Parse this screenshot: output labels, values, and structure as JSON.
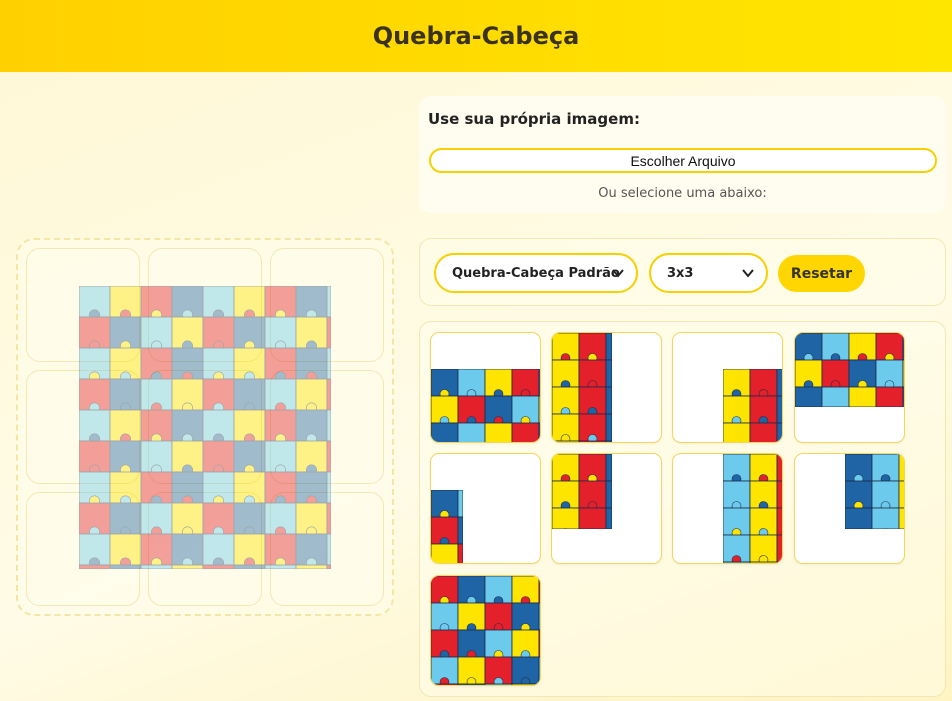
{
  "header": {
    "title": "Quebra-Cabeça"
  },
  "upload": {
    "title": "Use sua própria imagem:",
    "file_button": "Escolher Arquivo",
    "or_text": "Ou selecione uma abaixo:"
  },
  "controls": {
    "puzzle_select": "Quebra-Cabeça Padrão",
    "size_select": "3x3",
    "reset_label": "Resetar"
  },
  "pieces": {
    "count": 9,
    "colors": [
      "#e4202b",
      "#fde500",
      "#6ccbec",
      "#1f64a5"
    ]
  }
}
